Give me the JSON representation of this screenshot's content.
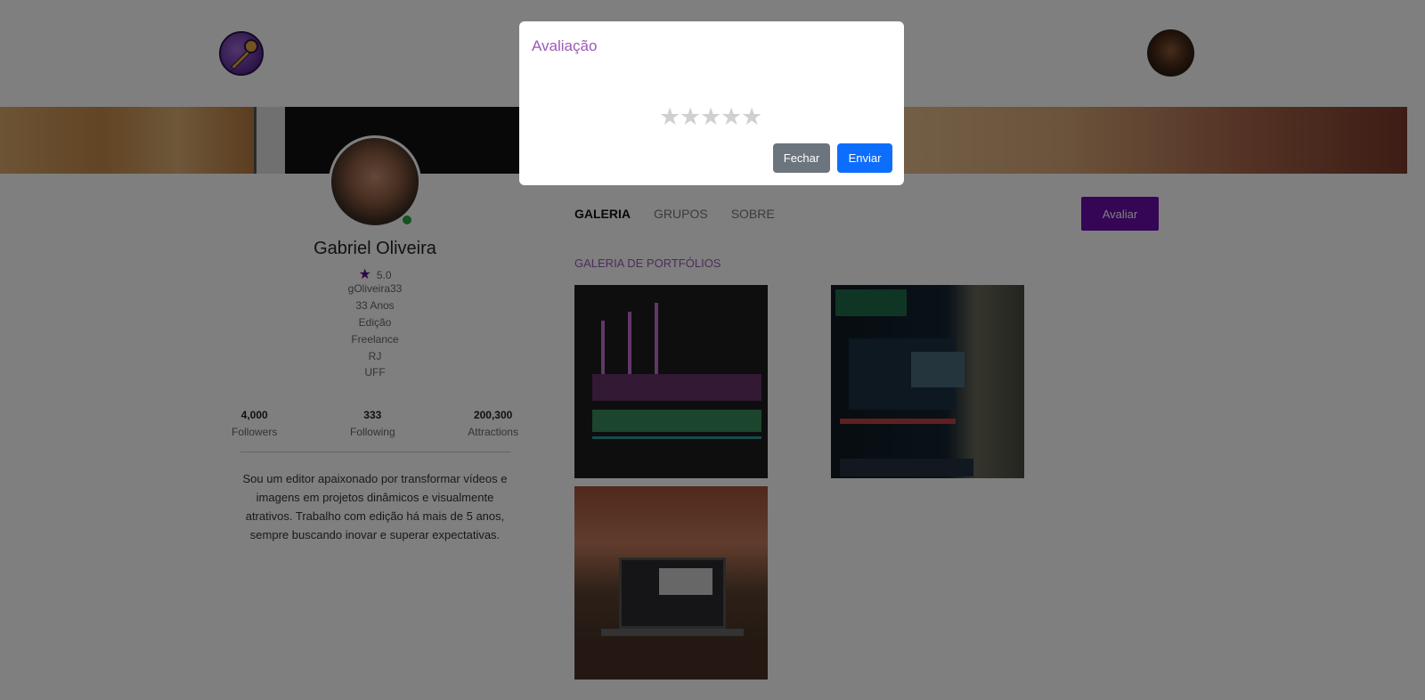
{
  "profile": {
    "name": "Gabriel Oliveira",
    "rating": "5.0",
    "username": "gOliveira33",
    "age": "33 Anos",
    "area": "Edição",
    "work_type": "Freelance",
    "state": "RJ",
    "university": "UFF",
    "stats": [
      {
        "value": "4,000",
        "label": "Followers"
      },
      {
        "value": "333",
        "label": "Following"
      },
      {
        "value": "200,300",
        "label": "Attractions"
      }
    ],
    "bio": "Sou um editor apaixonado por transformar vídeos e imagens em projetos dinâmicos e visualmente atrativos. Trabalho com edição há mais de 5 anos, sempre buscando inovar e superar expectativas."
  },
  "tabs": [
    "GALERIA",
    "GRUPOS",
    "SOBRE"
  ],
  "rate_button": "Avaliar",
  "gallery": {
    "title": "GALERIA DE PORTFÓLIOS"
  },
  "modal": {
    "title": "Avaliação",
    "stars": 5,
    "close_label": "Fechar",
    "send_label": "Enviar"
  },
  "colors": {
    "accent_purple": "#6a0dad",
    "title_purple": "#9b59b6",
    "primary_blue": "#0d6efd",
    "secondary_gray": "#6c757d",
    "online_green": "#28a745"
  }
}
